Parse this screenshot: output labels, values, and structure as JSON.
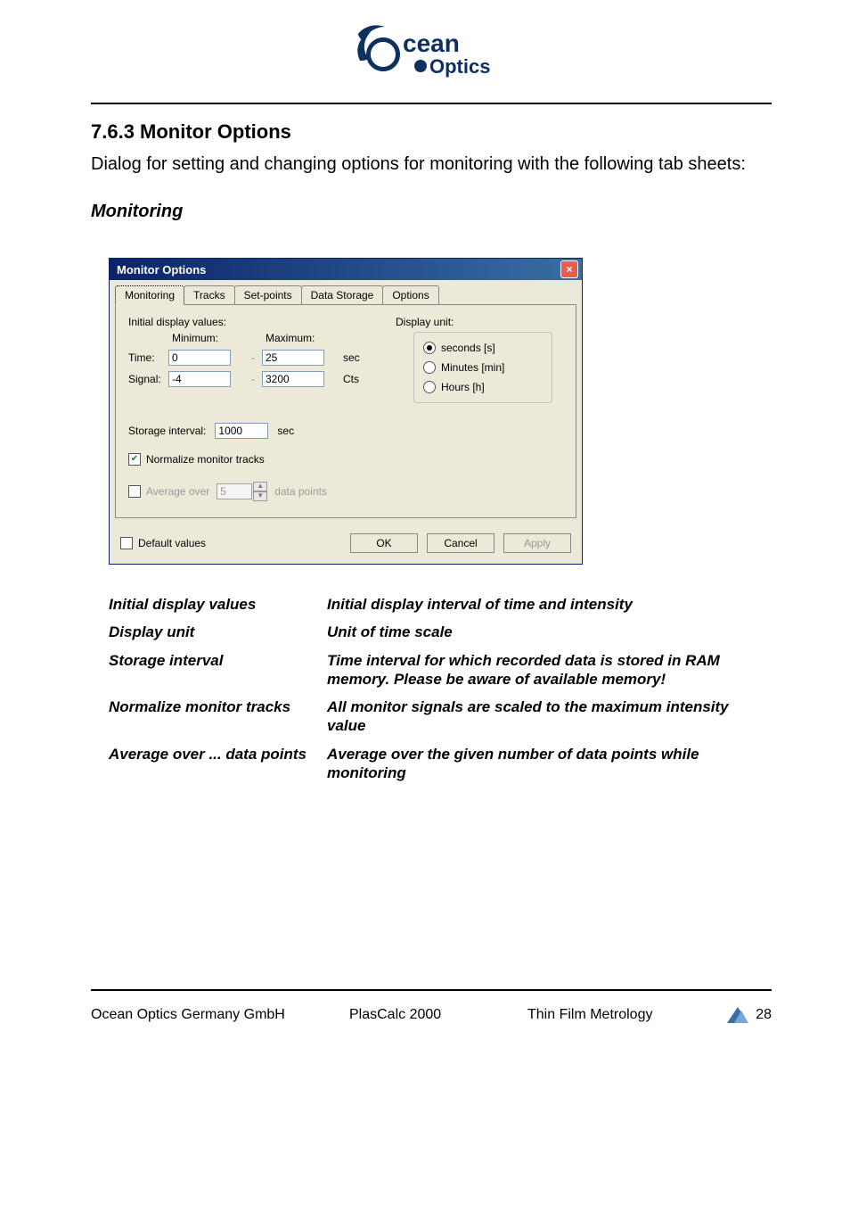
{
  "header": {
    "brand_top": "cean",
    "brand_bottom": "Optics"
  },
  "section": {
    "number_title": "7.6.3 Monitor Options",
    "intro": "Dialog for setting and changing options for monitoring with the following tab sheets:",
    "subhead": "Monitoring"
  },
  "dialog": {
    "title": "Monitor Options",
    "close": "×",
    "tabs": [
      "Monitoring",
      "Tracks",
      "Set-points",
      "Data Storage",
      "Options"
    ],
    "active_tab": 0,
    "initial_label": "Initial display values:",
    "min_label": "Minimum:",
    "max_label": "Maximum:",
    "time_label": "Time:",
    "signal_label": "Signal:",
    "time_min": "0",
    "time_max": "25",
    "time_unit": "sec",
    "signal_min": "-4",
    "signal_max": "3200",
    "signal_unit": "Cts",
    "display_unit_label": "Display unit:",
    "radio": {
      "seconds": "seconds [s]",
      "minutes": "Minutes [min]",
      "hours": "Hours [h]",
      "selected": "seconds"
    },
    "storage_label": "Storage interval:",
    "storage_value": "1000",
    "storage_unit": "sec",
    "normalize_label": "Normalize monitor tracks",
    "normalize_checked": true,
    "avg_label": "Average over",
    "avg_value": "5",
    "avg_suffix": "data points",
    "avg_checked": false,
    "default_label": "Default values",
    "default_checked": false,
    "btn_ok": "OK",
    "btn_cancel": "Cancel",
    "btn_apply": "Apply"
  },
  "desc": {
    "r1k": "Initial display values",
    "r1v": "Initial display interval of time and intensity",
    "r2k": "Display unit",
    "r2v": "Unit of time scale",
    "r3k": "Storage interval",
    "r3v": "Time interval for which recorded data is stored in RAM memory. Please be aware of available memory!",
    "r4k": "Normalize monitor tracks",
    "r4v": "All monitor signals are scaled to the maximum intensity value",
    "r5k": "Average over ... data points",
    "r5v": "Average over the given number of data points while monitoring"
  },
  "footer": {
    "left": "Ocean Optics Germany GmbH",
    "center": "PlasCalc 2000",
    "right": "Thin Film Metrology",
    "page": "28"
  }
}
